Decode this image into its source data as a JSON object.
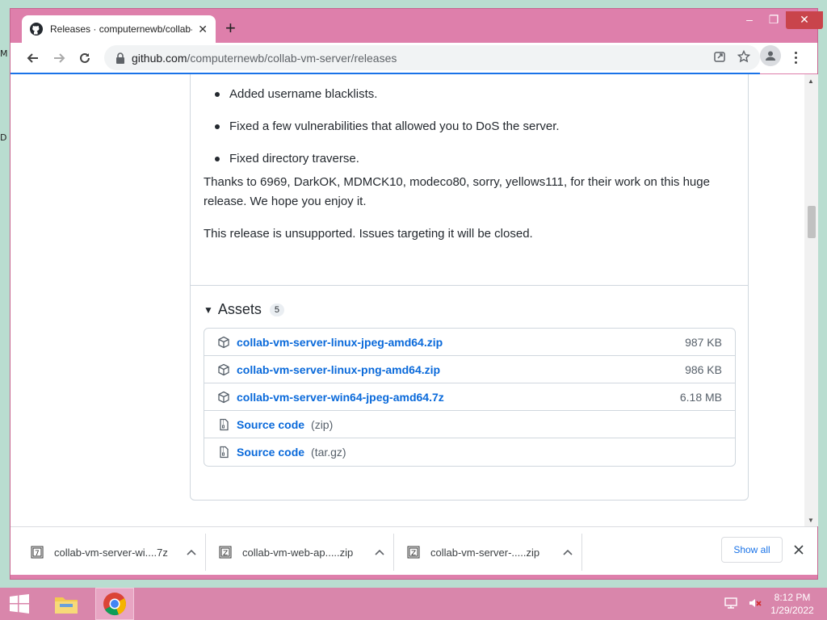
{
  "desktop": {
    "frag_1": "M",
    "frag_2": "D"
  },
  "browser": {
    "tab_title": "Releases · computernewb/collab-vm-server",
    "new_tab": "+",
    "url_host": "github.com",
    "url_path": "/computernewb/collab-vm-server/releases"
  },
  "release": {
    "notes": [
      "Added username blacklists.",
      "Fixed a few vulnerabilities that allowed you to DoS the server.",
      "Fixed directory traverse."
    ],
    "thanks": "Thanks to 6969, DarkOK, MDMCK10, modeco80, sorry, yellows111, for their work on this huge release. We hope you enjoy it.",
    "unsupported": "This release is unsupported. Issues targeting it will be closed.",
    "assets_title": "Assets",
    "assets_count": "5",
    "assets": [
      {
        "name": "collab-vm-server-linux-jpeg-amd64.zip",
        "size": "987 KB",
        "icon": "package-icon"
      },
      {
        "name": "collab-vm-server-linux-png-amd64.zip",
        "size": "986 KB",
        "icon": "package-icon"
      },
      {
        "name": "collab-vm-server-win64-jpeg-amd64.7z",
        "size": "6.18 MB",
        "icon": "package-icon"
      },
      {
        "name": "Source code",
        "sub": "(zip)",
        "icon": "file-zip-icon"
      },
      {
        "name": "Source code",
        "sub": "(tar.gz)",
        "icon": "file-zip-icon"
      }
    ]
  },
  "downloads": {
    "items": [
      {
        "name": "collab-vm-server-wi....7z"
      },
      {
        "name": "collab-vm-web-ap.....zip"
      },
      {
        "name": "collab-vm-server-.....zip"
      }
    ],
    "show_all": "Show all"
  },
  "taskbar": {
    "time": "8:12 PM",
    "date": "1/29/2022"
  },
  "colors": {
    "window_frame": "#de7fab",
    "link": "#0969da",
    "taskbar": "#d986ab"
  }
}
